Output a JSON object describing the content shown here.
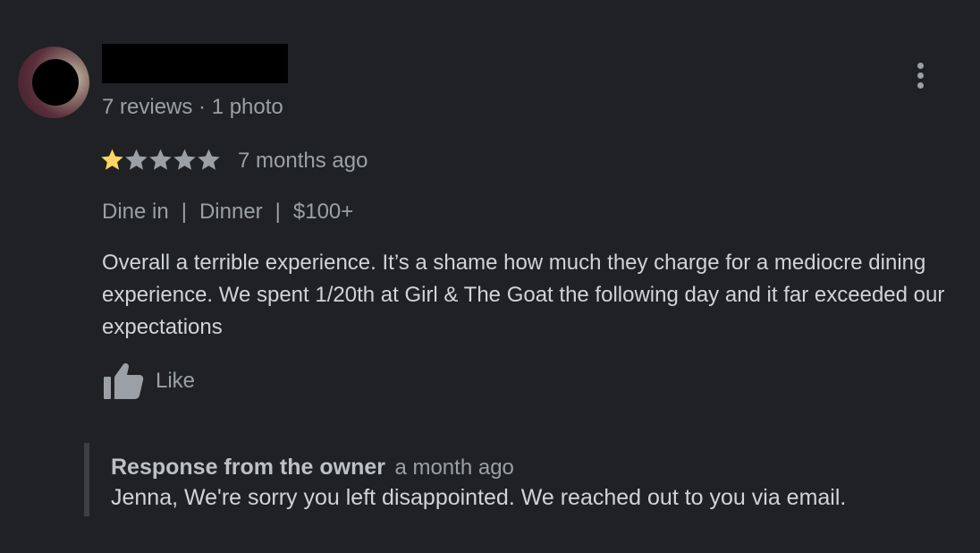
{
  "reviewer": {
    "stats": "7 reviews · 1 photo"
  },
  "review": {
    "rating": 1,
    "max_rating": 5,
    "time": "7 months ago",
    "tags": [
      "Dine in",
      "Dinner",
      "$100+"
    ],
    "text": "Overall a terrible experience. It’s a shame how much they charge for a mediocre dining experience. We spent 1/20th at Girl & The Goat the following day and it far exceeded our expectations",
    "like_label": "Like"
  },
  "owner_response": {
    "title": "Response from the owner",
    "time": "a month ago",
    "text": "Jenna, We're sorry you left disappointed. We reached out to you via email."
  },
  "colors": {
    "background": "#202124",
    "star_filled": "#fdd663",
    "star_empty": "#9aa0a6",
    "text_secondary": "#9aa0a6",
    "text_primary": "#d0d3d7"
  },
  "icons": {
    "more": "more-vert-icon",
    "like": "thumb-up-icon",
    "star": "star-icon"
  }
}
